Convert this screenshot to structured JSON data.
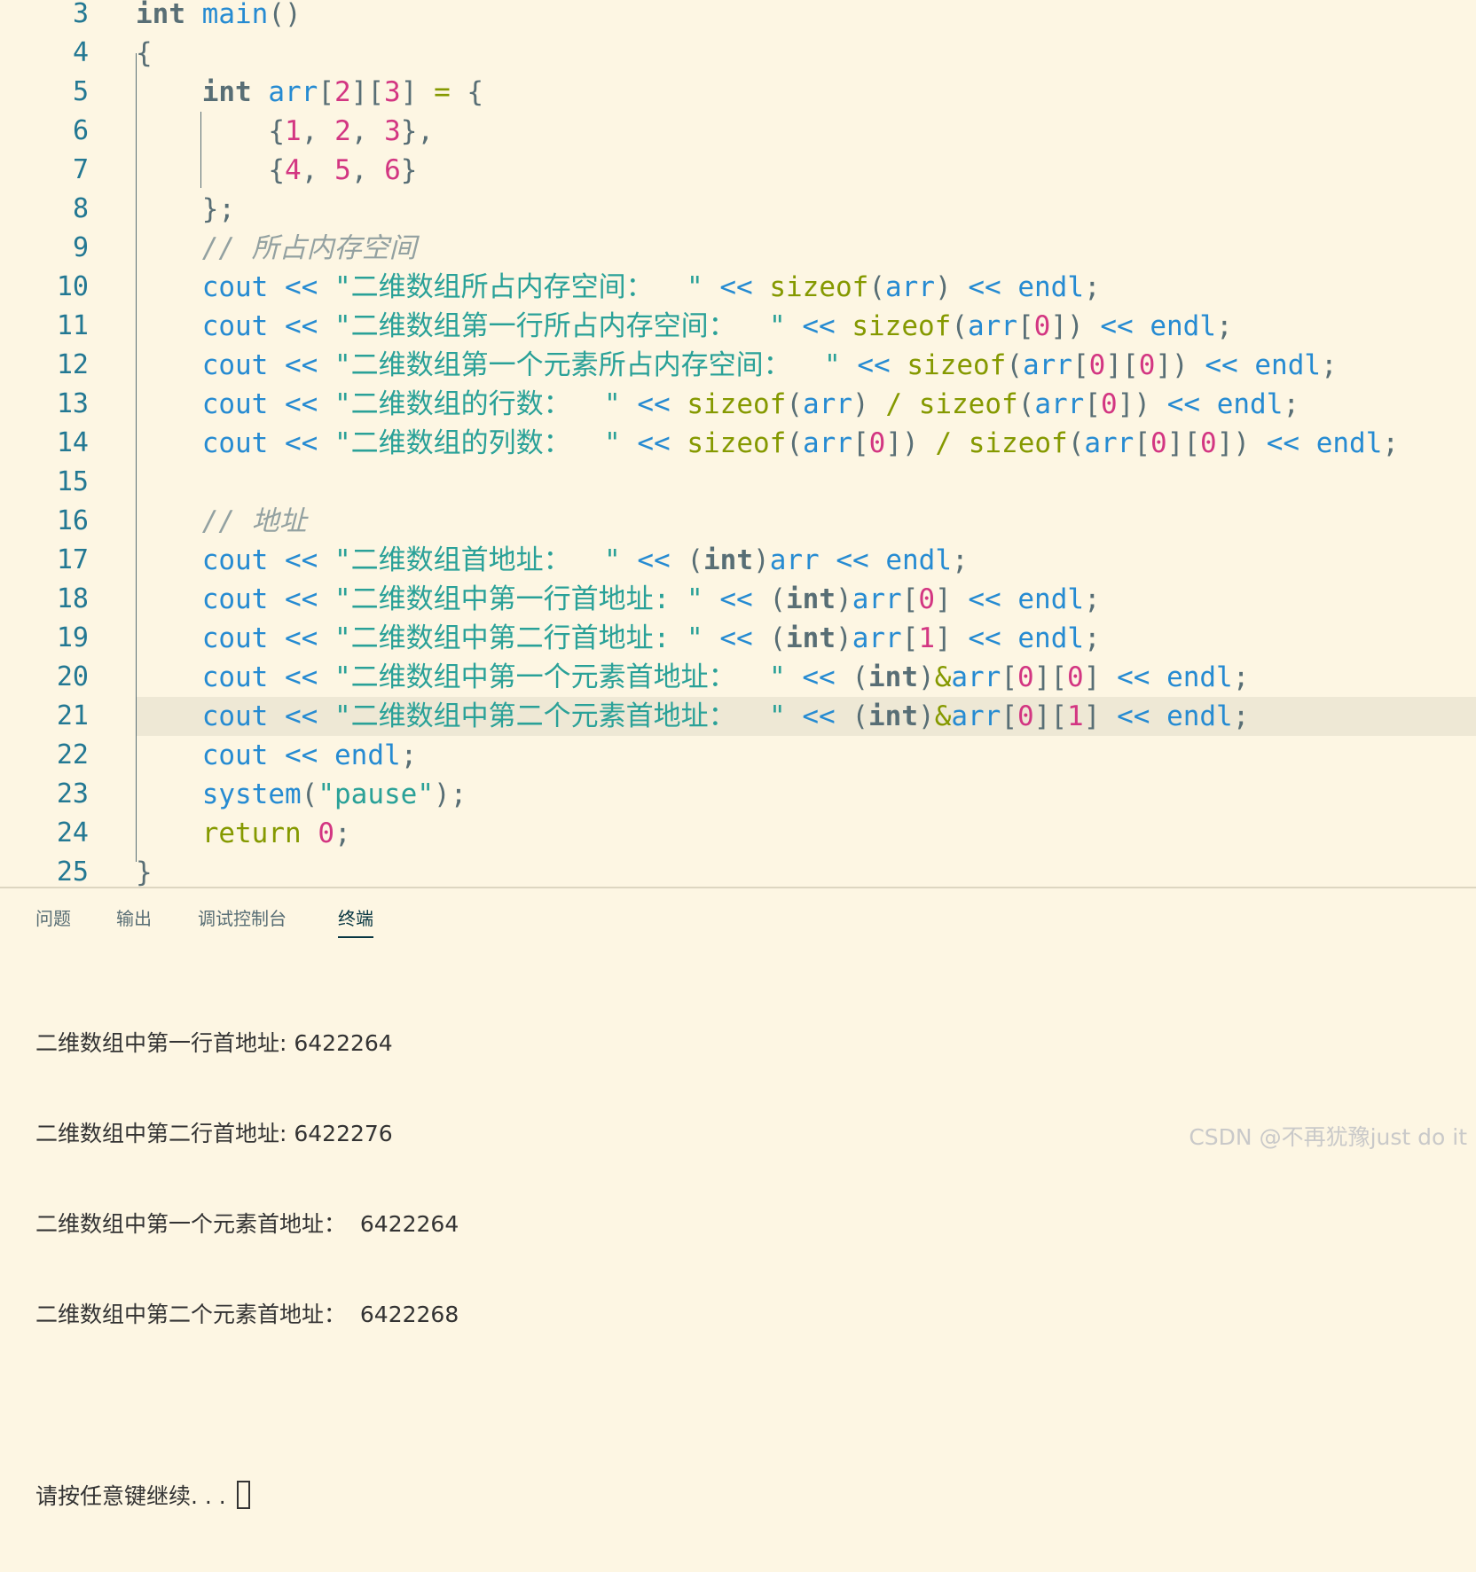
{
  "editor": {
    "lines": [
      {
        "n": "3",
        "code": "int main()"
      },
      {
        "n": "4",
        "code": "{"
      },
      {
        "n": "5",
        "code": "    int arr[2][3] = {"
      },
      {
        "n": "6",
        "code": "        {1, 2, 3},"
      },
      {
        "n": "7",
        "code": "        {4, 5, 6}"
      },
      {
        "n": "8",
        "code": "    };"
      },
      {
        "n": "9",
        "code": "    // 所占内存空间"
      },
      {
        "n": "10",
        "code": "    cout << \"二维数组所占内存空间：  \" << sizeof(arr) << endl;"
      },
      {
        "n": "11",
        "code": "    cout << \"二维数组第一行所占内存空间：  \" << sizeof(arr[0]) << endl;"
      },
      {
        "n": "12",
        "code": "    cout << \"二维数组第一个元素所占内存空间：  \" << sizeof(arr[0][0]) << endl;"
      },
      {
        "n": "13",
        "code": "    cout << \"二维数组的行数：  \" << sizeof(arr) / sizeof(arr[0]) << endl;"
      },
      {
        "n": "14",
        "code": "    cout << \"二维数组的列数：  \" << sizeof(arr[0]) / sizeof(arr[0][0]) << endl;"
      },
      {
        "n": "15",
        "code": ""
      },
      {
        "n": "16",
        "code": "    // 地址"
      },
      {
        "n": "17",
        "code": "    cout << \"二维数组首地址：  \" << (int)arr << endl;"
      },
      {
        "n": "18",
        "code": "    cout << \"二维数组中第一行首地址: \" << (int)arr[0] << endl;"
      },
      {
        "n": "19",
        "code": "    cout << \"二维数组中第二行首地址: \" << (int)arr[1] << endl;"
      },
      {
        "n": "20",
        "code": "    cout << \"二维数组中第一个元素首地址：  \" << (int)&arr[0][0] << endl;"
      },
      {
        "n": "21",
        "code": "    cout << \"二维数组中第二个元素首地址：  \" << (int)&arr[0][1] << endl;"
      },
      {
        "n": "22",
        "code": "    cout << endl;"
      },
      {
        "n": "23",
        "code": "    system(\"pause\");"
      },
      {
        "n": "24",
        "code": "    return 0;"
      },
      {
        "n": "25",
        "code": "}"
      }
    ],
    "current_line": "21"
  },
  "panel": {
    "tabs": [
      {
        "label": "问题",
        "active": false
      },
      {
        "label": "输出",
        "active": false
      },
      {
        "label": "调试控制台",
        "active": false
      },
      {
        "label": "终端",
        "active": true
      }
    ],
    "terminal_lines": [
      "二维数组中第一行首地址: 6422264",
      "二维数组中第二行首地址: 6422276",
      "二维数组中第一个元素首地址：  6422264",
      "二维数组中第二个元素首地址：  6422268",
      "",
      "请按任意键继续. . . "
    ]
  },
  "watermark": "CSDN @不再犹豫just do it"
}
